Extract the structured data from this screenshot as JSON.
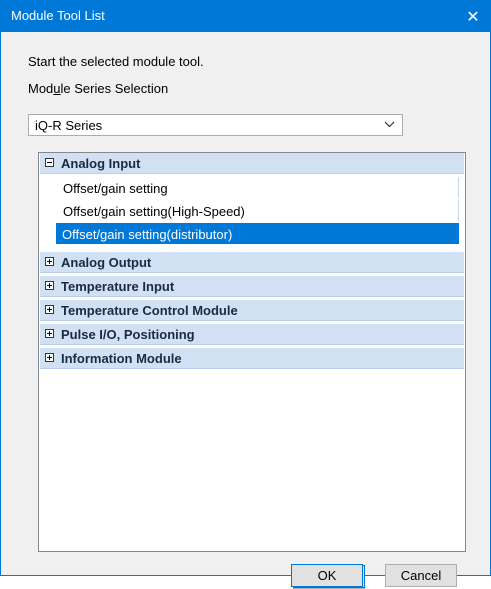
{
  "dialog": {
    "title": "Module Tool List",
    "close_glyph": "✕",
    "instruction": "Start the selected module tool.",
    "series_label_pre": "Mod",
    "series_label_mnemonic": "u",
    "series_label_post": "le Series Selection",
    "series_selected": "iQ-R Series"
  },
  "tree": {
    "categories": [
      {
        "label": "Analog Input",
        "expanded": true,
        "items": [
          {
            "label": "Offset/gain setting",
            "selected": false
          },
          {
            "label": "Offset/gain setting(High-Speed)",
            "selected": false
          },
          {
            "label": "Offset/gain setting(distributor)",
            "selected": true
          }
        ]
      },
      {
        "label": "Analog Output",
        "expanded": false
      },
      {
        "label": "Temperature Input",
        "expanded": false
      },
      {
        "label": "Temperature Control Module",
        "expanded": false
      },
      {
        "label": "Pulse I/O, Positioning",
        "expanded": false
      },
      {
        "label": "Information Module",
        "expanded": false
      }
    ]
  },
  "buttons": {
    "ok_label": "OK",
    "cancel_label": "Cancel"
  },
  "colors": {
    "titlebar": "#0078d7",
    "category_bg": "#d1e0f3",
    "selection": "#0078d7"
  }
}
